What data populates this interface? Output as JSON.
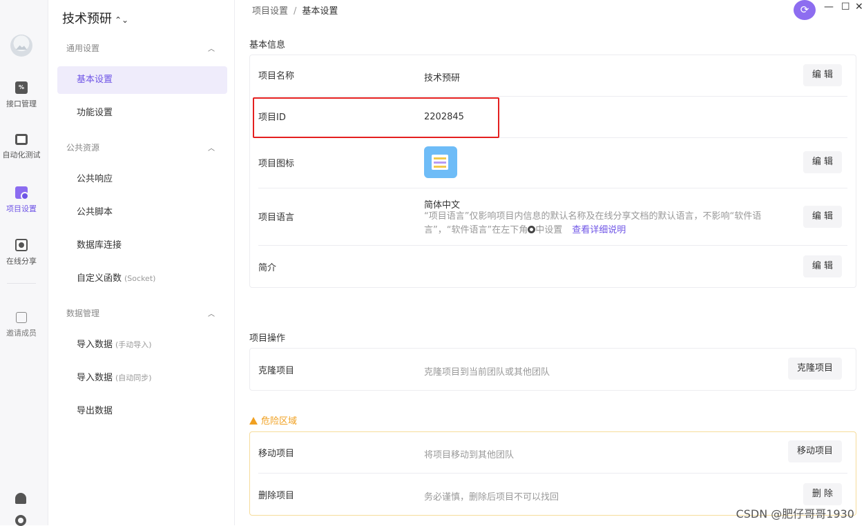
{
  "rail": {
    "items": [
      {
        "label": "接口管理",
        "icon": "api-icon"
      },
      {
        "label": "自动化测试",
        "icon": "automation-icon"
      },
      {
        "label": "项目设置",
        "icon": "project-settings-icon"
      },
      {
        "label": "在线分享",
        "icon": "share-icon"
      }
    ],
    "invite_label": "邀请成员"
  },
  "nav": {
    "project_title": "技术预研",
    "groups": [
      {
        "label": "通用设置",
        "items": [
          {
            "label": "基本设置",
            "sub": ""
          },
          {
            "label": "功能设置",
            "sub": ""
          }
        ]
      },
      {
        "label": "公共资源",
        "items": [
          {
            "label": "公共响应",
            "sub": ""
          },
          {
            "label": "公共脚本",
            "sub": ""
          },
          {
            "label": "数据库连接",
            "sub": ""
          },
          {
            "label": "自定义函数",
            "sub": "(Socket)"
          }
        ]
      },
      {
        "label": "数据管理",
        "items": [
          {
            "label": "导入数据",
            "sub": "(手动导入)"
          },
          {
            "label": "导入数据",
            "sub": "(自动同步)"
          },
          {
            "label": "导出数据",
            "sub": ""
          }
        ]
      }
    ]
  },
  "breadcrumb": {
    "parent": "项目设置",
    "separator": "/",
    "current": "基本设置"
  },
  "basic_info": {
    "title": "基本信息",
    "rows": {
      "name": {
        "label": "项目名称",
        "value": "技术预研",
        "button": "编 辑"
      },
      "id": {
        "label": "项目ID",
        "value": "2202845"
      },
      "icon": {
        "label": "项目图标",
        "button": "编 辑"
      },
      "language": {
        "label": "项目语言",
        "value": "简体中文",
        "note_part1": "“项目语言”仅影响项目内信息的默认名称及在线分享文档的默认语言，不影响“软件语言”，“软件语言”在左下角",
        "note_part2": "中设置",
        "link": "查看详细说明",
        "button": "编 辑"
      },
      "intro": {
        "label": "简介",
        "button": "编 辑"
      }
    }
  },
  "operations": {
    "title": "项目操作",
    "clone": {
      "label": "克隆项目",
      "desc": "克隆项目到当前团队或其他团队",
      "button": "克隆项目"
    }
  },
  "danger": {
    "title": "危险区域",
    "move": {
      "label": "移动项目",
      "desc": "将项目移动到其他团队",
      "button": "移动项目"
    },
    "delete": {
      "label": "删除项目",
      "desc": "务必谨慎，删除后项目不可以找回",
      "button": "删 除"
    }
  },
  "window": {
    "minimize": "—",
    "maximize": "☐",
    "close": "✕"
  },
  "watermark": "CSDN @肥仔哥哥1930",
  "colors": {
    "accent": "#6f55e6",
    "warning": "#f0a020",
    "highlight_box": "#e41f1f"
  }
}
